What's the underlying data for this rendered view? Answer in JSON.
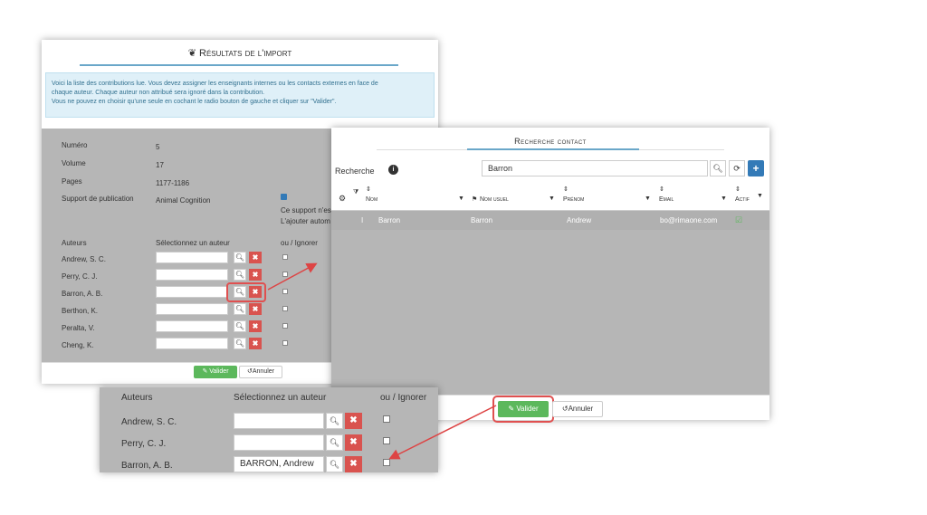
{
  "import_dialog": {
    "title": "Résultats de l'import",
    "info_line1": "Voici la liste des contributions lue. Vous devez assigner les enseignants internes ou les contacts externes en face de",
    "info_line2": "chaque auteur. Chaque auteur non attribué sera ignoré dans la contribution.",
    "info_line3": "Vous ne pouvez en choisir qu'une seule en cochant le radio bouton de gauche et cliquer sur \"Valider\".",
    "fields": [
      {
        "label": "Numéro",
        "value": "5"
      },
      {
        "label": "Volume",
        "value": "17"
      },
      {
        "label": "Pages",
        "value": "1177-1186"
      },
      {
        "label": "Support de publication",
        "value": "Animal Cognition"
      }
    ],
    "support_note_1": "Ce support n'es",
    "support_note_2": "L'ajouter autom",
    "col_authors": "Auteurs",
    "col_select": "Sélectionnez un auteur",
    "col_ignore": "ou / Ignorer",
    "authors": [
      "Andrew, S. C.",
      "Perry, C. J.",
      "Barron, A. B.",
      "Berthon, K.",
      "Peralta, V.",
      "Cheng, K."
    ],
    "valider": "Valider",
    "annuler": "Annuler"
  },
  "contact_dialog": {
    "title": "Recherche contact",
    "search_label": "Recherche",
    "search_value": "Barron",
    "columns": [
      "Nom",
      "Nom usuel",
      "Prénom",
      "Email",
      "Actif"
    ],
    "row": {
      "nom": "Barron",
      "nom_usuel": "Barron",
      "prenom": "Andrew",
      "email": "bo@rimaone.com",
      "index": "I"
    },
    "valider": "Valider",
    "annuler": "Annuler"
  },
  "zoom": {
    "col_authors": "Auteurs",
    "col_select": "Sélectionnez un auteur",
    "col_ignore": "ou / Ignorer",
    "authors": [
      "Andrew, S. C.",
      "Perry, C. J.",
      "Barron, A. B."
    ],
    "selected_value": "BARRON, Andrew"
  },
  "colors": {
    "accent": "#6aa7c9",
    "success": "#5cb85c",
    "danger": "#d9534f",
    "highlight": "#e05050",
    "primary": "#337ab7"
  }
}
